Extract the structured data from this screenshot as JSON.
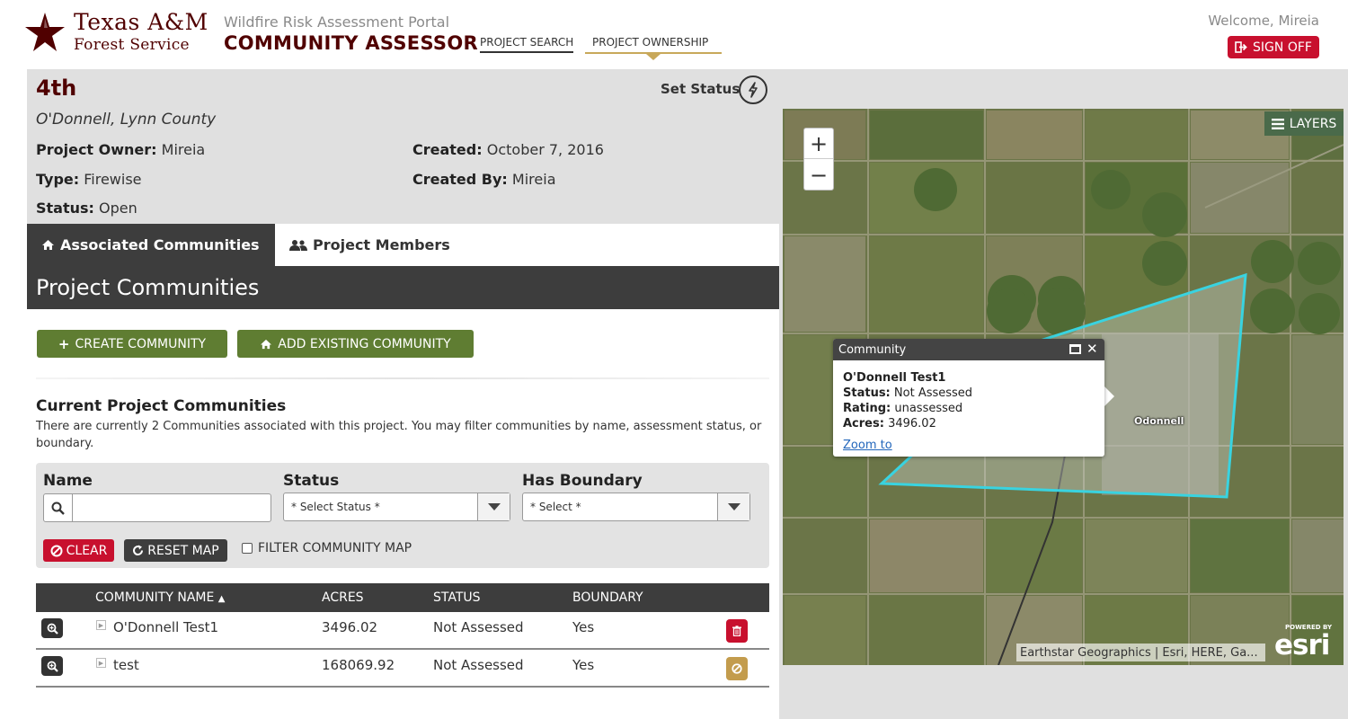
{
  "header": {
    "logo_line1": "Texas A&M",
    "logo_line2": "Forest Service",
    "portal_subtitle": "Wildfire Risk Assessment Portal",
    "portal_title": "COMMUNITY ASSESSOR",
    "nav": [
      {
        "label": "PROJECT SEARCH"
      },
      {
        "label": "PROJECT OWNERSHIP",
        "active": true
      }
    ],
    "welcome": "Welcome, Mireia",
    "sign_off": "SIGN OFF"
  },
  "project": {
    "name": "4th",
    "location": "O'Donnell, Lynn County",
    "set_status": "Set Status",
    "owner_label": "Project Owner:",
    "owner": "Mireia",
    "type_label": "Type:",
    "type": "Firewise",
    "status_label": "Status:",
    "status": "Open",
    "created_label": "Created:",
    "created": "October 7, 2016",
    "created_by_label": "Created By:",
    "created_by": "Mireia"
  },
  "tabs": [
    {
      "label": "Associated Communities",
      "active": true
    },
    {
      "label": "Project Members",
      "active": false
    }
  ],
  "section_title": "Project Communities",
  "buttons": {
    "create": "CREATE COMMUNITY",
    "add_existing": "ADD EXISTING COMMUNITY"
  },
  "current": {
    "title": "Current Project Communities",
    "description": "There are currently 2 Communities associated with this project. You may filter communities by name, assessment status, or boundary."
  },
  "filters": {
    "name_label": "Name",
    "name_value": "",
    "status_label": "Status",
    "status_value": "* Select Status *",
    "boundary_label": "Has Boundary",
    "boundary_value": "* Select *",
    "clear": "CLEAR",
    "reset_map": "RESET MAP",
    "filter_map": "FILTER COMMUNITY MAP"
  },
  "table": {
    "columns": [
      "COMMUNITY NAME",
      "ACRES",
      "STATUS",
      "BOUNDARY"
    ],
    "rows": [
      {
        "name": "O'Donnell Test1",
        "acres": "3496.02",
        "status": "Not Assessed",
        "boundary": "Yes",
        "action": "delete"
      },
      {
        "name": "test",
        "acres": "168069.92",
        "status": "Not Assessed",
        "boundary": "Yes",
        "action": "remove"
      }
    ]
  },
  "map": {
    "layers_label": "LAYERS",
    "zoom_in": "+",
    "zoom_out": "−",
    "place_label": "Odonnell",
    "attribution": "Earthstar Geographics | Esri, HERE, Ga...",
    "esri_powered": "POWERED BY",
    "esri": "esri",
    "popup": {
      "header": "Community",
      "name": "O'Donnell Test1",
      "status_label": "Status:",
      "status": "Not Assessed",
      "rating_label": "Rating:",
      "rating": "unassessed",
      "acres_label": "Acres:",
      "acres": "3496.02",
      "zoom_to": "Zoom to"
    }
  },
  "colors": {
    "maroon": "#500000",
    "green_button": "#5f7d32",
    "red_button": "#c8102e",
    "dark": "#3d3d3d",
    "boundary": "#39d3e0",
    "gold": "#c8a85a"
  }
}
